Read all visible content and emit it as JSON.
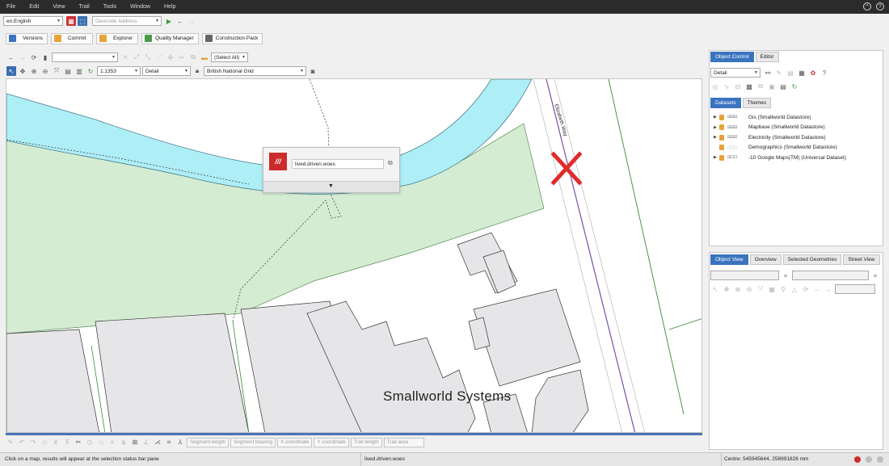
{
  "menu": [
    "File",
    "Edit",
    "View",
    "Trail",
    "Tools",
    "Window",
    "Help"
  ],
  "window_controls": {
    "collapse": "^",
    "help": "?"
  },
  "toolbar1": {
    "language": "en.English",
    "geocode_placeholder": "Geocode Address"
  },
  "app_buttons": [
    {
      "label": "Versions",
      "icon": "versions-icon",
      "color": "#3a74bf"
    },
    {
      "label": "Commit",
      "icon": "commit-icon",
      "color": "#e7a33a"
    },
    {
      "label": "Explorer",
      "icon": "explorer-icon",
      "color": "#e7a33a"
    },
    {
      "label": "Quality Manager",
      "icon": "quality-manager-icon",
      "color": "#4a9a4a"
    },
    {
      "label": "Construction Pack",
      "icon": "construction-pack-icon",
      "color": "#666666"
    }
  ],
  "map_toolbar": {
    "select_all": "(Select All)",
    "scale": "1:1353",
    "detail": "Detail",
    "crs": "British National Grid"
  },
  "map": {
    "title_label": "Smallworld  Systems",
    "road_label": "Elizabeth Way"
  },
  "popup": {
    "logo_text": "///",
    "w3w_value": "lived.driven.woes"
  },
  "bottom_tools": {
    "fields": [
      "Segment length",
      "Segment bearing",
      "X coordinate",
      "Y coordinate",
      "Trail length",
      "Trail area"
    ]
  },
  "status": {
    "hint": "Click on a map, results will appear at the selection status bar pane",
    "selection": "lived.driven.woes",
    "centre": "Centre: 545945644, 258991826 mm",
    "dot_colors": [
      "#cc2b2b",
      "#bdbdbd",
      "#bdbdbd",
      "#bdbdbd"
    ]
  },
  "right_panel": {
    "top_tabs": [
      "Object Control",
      "Editor"
    ],
    "detail_select": "Detail",
    "sub_tabs": [
      "Datasets",
      "Themes"
    ],
    "datasets": [
      {
        "label": "Gis (Smallworld Datastore)",
        "checks": "☑☑☑",
        "expand": true
      },
      {
        "label": "Mapbase (Smallworld Datastore)",
        "checks": "☑☑☑",
        "expand": true
      },
      {
        "label": "Electricity (Smallworld Datastore)",
        "checks": "☑☑☑",
        "expand": true
      },
      {
        "label": "Demographics (Smallworld Datastore)",
        "checks": "☐☐☐",
        "expand": false
      },
      {
        "label": "-10 Google Maps(TM) (Universal Dataset)",
        "checks": "☑☐☐",
        "expand": true
      }
    ],
    "view_tabs": [
      "Object View",
      "Overview",
      "Selected Geometries",
      "Street View"
    ]
  },
  "colors": {
    "accent": "#3a74bf",
    "river": "#aeeef7",
    "park": "#d4edd2",
    "building": "#e6e6e8",
    "marker": "#e02b2b"
  }
}
